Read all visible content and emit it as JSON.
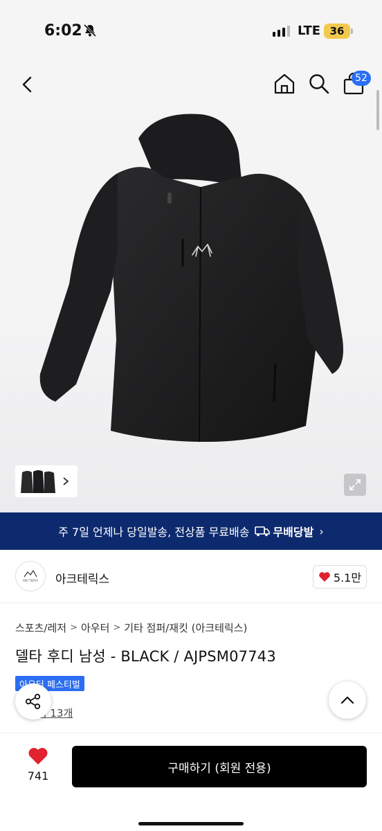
{
  "status_bar": {
    "time": "6:02",
    "network": "LTE",
    "battery": "36"
  },
  "nav": {
    "cart_count": "52"
  },
  "banner": {
    "text": "주 7일 언제나 당일발송, 전상품 무료배송",
    "badge": "무배당발",
    "chevron": "›"
  },
  "brand": {
    "name": "아크테릭스",
    "logo_text": "ARC'TERYX",
    "likes": "5.1만"
  },
  "breadcrumb": [
    "스포츠/레저",
    "아우터",
    "기타 점퍼/재킷 (아크테릭스)"
  ],
  "product": {
    "title": "델타 후디 남성 - BLACK / AJPSM07743",
    "badge": "아우터 페스티벌",
    "review_label": "후기 13개"
  },
  "bottom": {
    "wish_count": "741",
    "buy_label": "구매하기 (회원 전용)"
  },
  "colors": {
    "banner": "#0d2a6e",
    "accent": "#2b6ef2",
    "heart": "#e0232e",
    "buy": "#000000"
  }
}
